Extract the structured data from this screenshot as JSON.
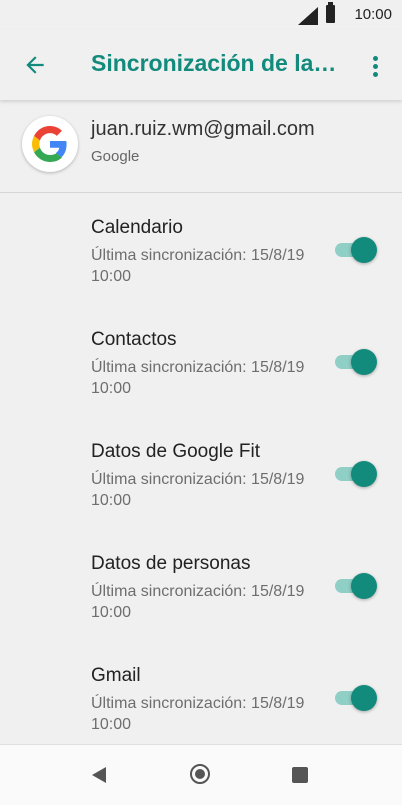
{
  "status_bar": {
    "time": "10:00"
  },
  "app_bar": {
    "title": "Sincronización de la cuenta"
  },
  "account": {
    "email": "juan.ruiz.wm@gmail.com",
    "type": "Google"
  },
  "sync_items": [
    {
      "title": "Calendario",
      "subtitle": "Última sincronización: 15/8/19 10:00",
      "enabled": true
    },
    {
      "title": "Contactos",
      "subtitle": "Última sincronización: 15/8/19 10:00",
      "enabled": true
    },
    {
      "title": "Datos de Google Fit",
      "subtitle": "Última sincronización: 15/8/19 10:00",
      "enabled": true
    },
    {
      "title": "Datos de personas",
      "subtitle": "Última sincronización: 15/8/19 10:00",
      "enabled": true
    },
    {
      "title": "Gmail",
      "subtitle": "Última sincronización: 15/8/19 10:00",
      "enabled": true
    }
  ],
  "colors": {
    "accent": "#128a7c",
    "track": "#8fcfc6",
    "background": "#f0f0f0"
  },
  "icons": [
    "signal-icon",
    "battery-icon",
    "back-arrow-icon",
    "more-vert-icon",
    "google-logo-icon",
    "nav-back-icon",
    "nav-home-icon",
    "nav-recents-icon"
  ]
}
